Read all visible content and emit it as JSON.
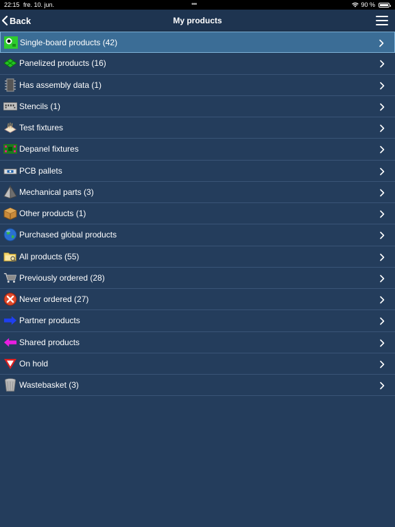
{
  "status": {
    "time": "22:15",
    "date": "fre. 10. jun.",
    "battery": "90 %",
    "battery_level": 0.9
  },
  "nav": {
    "back_label": "Back",
    "title": "My products"
  },
  "rows": [
    {
      "label": "Single-board products (42)",
      "icon": "green-board-icon",
      "selected": true
    },
    {
      "label": "Panelized products (16)",
      "icon": "panel-icon"
    },
    {
      "label": "Has assembly data (1)",
      "icon": "chip-icon"
    },
    {
      "label": "Stencils (1)",
      "icon": "stencil-icon"
    },
    {
      "label": "Test fixtures",
      "icon": "test-fixture-icon"
    },
    {
      "label": "Depanel fixtures",
      "icon": "depanel-fixture-icon"
    },
    {
      "label": "PCB pallets",
      "icon": "pallet-icon"
    },
    {
      "label": "Mechanical parts (3)",
      "icon": "pyramid-icon"
    },
    {
      "label": "Other products (1)",
      "icon": "box-icon"
    },
    {
      "label": "Purchased global products",
      "icon": "globe-icon"
    },
    {
      "label": "All products (55)",
      "icon": "folder-icon"
    },
    {
      "label": "Previously ordered (28)",
      "icon": "cart-icon"
    },
    {
      "label": "Never ordered (27)",
      "icon": "red-x-icon"
    },
    {
      "label": "Partner products",
      "icon": "blue-arrow-icon"
    },
    {
      "label": "Shared products",
      "icon": "magenta-arrow-icon"
    },
    {
      "label": "On hold",
      "icon": "yield-icon"
    },
    {
      "label": "Wastebasket (3)",
      "icon": "trash-icon"
    }
  ]
}
